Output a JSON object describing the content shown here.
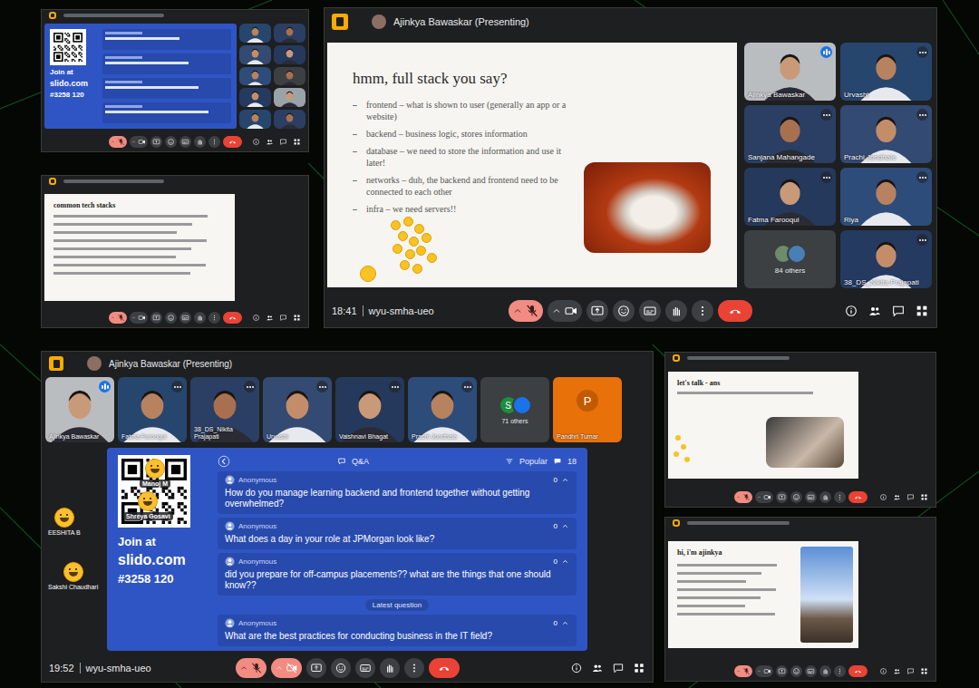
{
  "windows": {
    "topLeft": {
      "slido": {
        "join": "Join at",
        "site": "slido.com",
        "code": "#3258 120"
      },
      "controls": {
        "micMuted": true,
        "camOff": false
      }
    },
    "midLeft": {
      "slide": {
        "title": "common tech stacks"
      },
      "controls": {
        "micMuted": true,
        "camOff": false
      }
    },
    "main": {
      "presenter": "Ajinkya Bawaskar (Presenting)",
      "slide": {
        "title": "hmm, full stack you say?",
        "bullets": [
          "frontend – what is shown to user (generally an app or a website)",
          "backend – business logic, stores information",
          "database – we need to store the information and use it later!",
          "networks – duh, the backend and frontend need to be connected to each other",
          "infra – we need servers!!"
        ]
      },
      "tiles": [
        {
          "kind": "video",
          "name": "Ajinkya Bawaskar",
          "speaking": true
        },
        {
          "kind": "video",
          "name": "Urvashi",
          "speaking": false
        },
        {
          "kind": "video",
          "name": "Sanjana Mahangade",
          "speaking": false
        },
        {
          "kind": "video",
          "name": "Prachi Jondhale",
          "speaking": false
        },
        {
          "kind": "video",
          "name": "Fatma Farooqui",
          "speaking": false
        },
        {
          "kind": "video",
          "name": "Riya",
          "speaking": false
        },
        {
          "kind": "others",
          "name": "84 others",
          "avatars": []
        },
        {
          "kind": "video",
          "name": "38_DS_Nikita Prajapati",
          "speaking": false
        }
      ],
      "time": "18:41",
      "code": "wyu-smha-ueo",
      "controls": {
        "micMuted": true,
        "camOff": false
      }
    },
    "qa": {
      "presenter": "Ajinkya Bawaskar (Presenting)",
      "tiles": [
        {
          "kind": "video",
          "name": "Ajinkya Bawaskar",
          "speaking": true
        },
        {
          "kind": "video",
          "name": "Fatma Farooqui",
          "speaking": false
        },
        {
          "kind": "video",
          "name": "38_DS_Nikita Prajapati",
          "speaking": false
        },
        {
          "kind": "video",
          "name": "Urvashi",
          "speaking": false
        },
        {
          "kind": "video",
          "name": "Vaishnavi Bhagat",
          "speaking": false
        },
        {
          "kind": "video",
          "name": "Prachi Jondhale",
          "speaking": false
        },
        {
          "kind": "others",
          "name": "71 others",
          "avatars": [
            "S"
          ]
        },
        {
          "kind": "avatar",
          "name": "Pandhri Tumar",
          "letter": "P"
        }
      ],
      "slido": {
        "join": "Join at",
        "site": "slido.com",
        "code": "#3258 120",
        "tab": "Q&A",
        "sort": "Popular",
        "count": "18",
        "questions": [
          {
            "author": "Anonymous",
            "likes": "0",
            "text": "How do you manage learning backend and frontend together without getting overwhelmed?"
          },
          {
            "author": "Anonymous",
            "likes": "0",
            "text": "What does a day in your role at JPMorgan look like?"
          },
          {
            "author": "Anonymous",
            "likes": "0",
            "text": "did you prepare for off-campus placements?? what are the things that one should know??"
          }
        ],
        "latest": {
          "label": "Latest question",
          "question": {
            "author": "Anonymous",
            "likes": "0",
            "text": "What are the best practices for conducting business in the IT field?"
          }
        }
      },
      "reactions": [
        {
          "name": "EESHITA B"
        },
        {
          "name": "Manoj M"
        },
        {
          "name": "Shreya Gosavi"
        },
        {
          "name": "Sakshi Chaudhari"
        }
      ],
      "time": "19:52",
      "code": "wyu-smha-ueo",
      "controls": {
        "micMuted": true,
        "camOff": true
      }
    },
    "midRight": {
      "slide": {
        "title": "let's talk - ans"
      },
      "controls": {
        "micMuted": true,
        "camOff": false
      }
    },
    "bottomRight": {
      "slide": {
        "title": "hi, i'm ajinkya"
      },
      "controls": {
        "micMuted": true,
        "camOff": false
      }
    }
  }
}
